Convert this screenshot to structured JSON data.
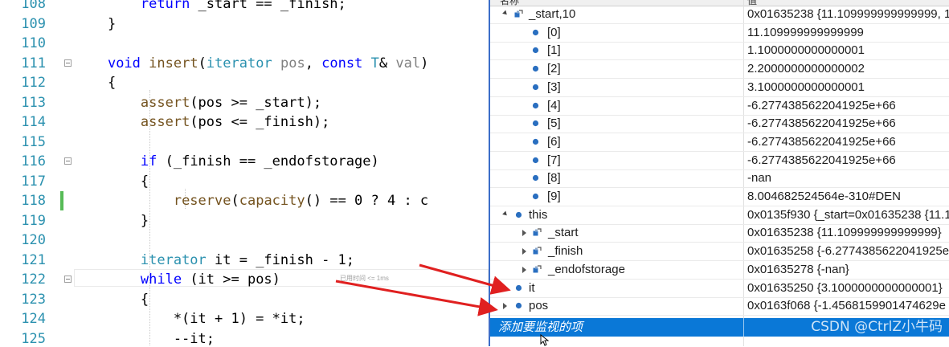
{
  "editor": {
    "lines": [
      {
        "num": "108",
        "tokens": [
          {
            "t": "        "
          },
          {
            "t": "return",
            "c": "kw"
          },
          {
            "t": " _start == _finish;"
          }
        ]
      },
      {
        "num": "109",
        "tokens": [
          {
            "t": "    }"
          }
        ]
      },
      {
        "num": "110",
        "tokens": []
      },
      {
        "num": "111",
        "fold": true,
        "tokens": [
          {
            "t": "    "
          },
          {
            "t": "void",
            "c": "kw"
          },
          {
            "t": " "
          },
          {
            "t": "insert",
            "c": "fn"
          },
          {
            "t": "("
          },
          {
            "t": "iterator",
            "c": "ty"
          },
          {
            "t": " "
          },
          {
            "t": "pos",
            "c": "pa"
          },
          {
            "t": ", "
          },
          {
            "t": "const",
            "c": "kw"
          },
          {
            "t": " "
          },
          {
            "t": "T",
            "c": "ty"
          },
          {
            "t": "& "
          },
          {
            "t": "val",
            "c": "pa"
          },
          {
            "t": ")"
          }
        ]
      },
      {
        "num": "112",
        "tokens": [
          {
            "t": "    {"
          }
        ]
      },
      {
        "num": "113",
        "tokens": [
          {
            "t": "        "
          },
          {
            "t": "assert",
            "c": "fn"
          },
          {
            "t": "(pos >= _start);"
          }
        ]
      },
      {
        "num": "114",
        "tokens": [
          {
            "t": "        "
          },
          {
            "t": "assert",
            "c": "fn"
          },
          {
            "t": "(pos <= _finish);"
          }
        ]
      },
      {
        "num": "115",
        "tokens": []
      },
      {
        "num": "116",
        "fold": true,
        "tokens": [
          {
            "t": "        "
          },
          {
            "t": "if",
            "c": "kw"
          },
          {
            "t": " (_finish == _endofstorage)"
          }
        ]
      },
      {
        "num": "117",
        "tokens": [
          {
            "t": "        {"
          }
        ]
      },
      {
        "num": "118",
        "changed": true,
        "tokens": [
          {
            "t": "            "
          },
          {
            "t": "reserve",
            "c": "fn"
          },
          {
            "t": "("
          },
          {
            "t": "capacity",
            "c": "fn"
          },
          {
            "t": "() == 0 ? 4 : c"
          }
        ]
      },
      {
        "num": "119",
        "tokens": [
          {
            "t": "        }"
          }
        ]
      },
      {
        "num": "120",
        "tokens": []
      },
      {
        "num": "121",
        "tokens": [
          {
            "t": "        "
          },
          {
            "t": "iterator",
            "c": "ty"
          },
          {
            "t": " it = _finish - 1;"
          }
        ]
      },
      {
        "num": "122",
        "fold": true,
        "tokens": [
          {
            "t": "        "
          },
          {
            "t": "while",
            "c": "kw"
          },
          {
            "t": " (it >= pos)"
          }
        ]
      },
      {
        "num": "123",
        "tokens": [
          {
            "t": "        {"
          }
        ]
      },
      {
        "num": "124",
        "tokens": [
          {
            "t": "            *(it + 1) = *it;"
          }
        ]
      },
      {
        "num": "125",
        "tokens": [
          {
            "t": "            --it;"
          }
        ]
      }
    ],
    "perf_tip": "已用时间 <= 1ms"
  },
  "watch": {
    "header": {
      "name_col": "名称",
      "value_col": "值"
    },
    "rows": [
      {
        "name": "_start,10",
        "value": "0x01635238 {11.109999999999999, 1",
        "indent": 0,
        "expander": "open",
        "icon": "field"
      },
      {
        "name": "[0]",
        "value": "11.109999999999999",
        "indent": 2,
        "icon": "var"
      },
      {
        "name": "[1]",
        "value": "1.1000000000000001",
        "indent": 2,
        "icon": "var"
      },
      {
        "name": "[2]",
        "value": "2.2000000000000002",
        "indent": 2,
        "icon": "var"
      },
      {
        "name": "[3]",
        "value": "3.1000000000000001",
        "indent": 2,
        "icon": "var"
      },
      {
        "name": "[4]",
        "value": "-6.2774385622041925e+66",
        "indent": 2,
        "icon": "var"
      },
      {
        "name": "[5]",
        "value": "-6.2774385622041925e+66",
        "indent": 2,
        "icon": "var"
      },
      {
        "name": "[6]",
        "value": "-6.2774385622041925e+66",
        "indent": 2,
        "icon": "var"
      },
      {
        "name": "[7]",
        "value": "-6.2774385622041925e+66",
        "indent": 2,
        "icon": "var"
      },
      {
        "name": "[8]",
        "value": "-nan",
        "indent": 2,
        "icon": "var"
      },
      {
        "name": "[9]",
        "value": "8.004682524564e-310#DEN",
        "indent": 2,
        "icon": "var"
      },
      {
        "name": "this",
        "value": "0x0135f930 {_start=0x01635238 {11.1",
        "indent": 0,
        "expander": "open",
        "icon": "var"
      },
      {
        "name": "_start",
        "value": "0x01635238 {11.109999999999999}",
        "indent": 1,
        "expander": "closed",
        "icon": "field"
      },
      {
        "name": "_finish",
        "value": "0x01635258 {-6.2774385622041925e",
        "indent": 1,
        "expander": "closed",
        "icon": "field"
      },
      {
        "name": "_endofstorage",
        "value": "0x01635278 {-nan}",
        "indent": 1,
        "expander": "closed",
        "icon": "field"
      },
      {
        "name": "it",
        "value": "0x01635250 {3.1000000000000001}",
        "indent": 0,
        "expander": "closed",
        "icon": "var"
      },
      {
        "name": "pos",
        "value": "0x0163f068 {-1.4568159901474629e",
        "indent": 0,
        "expander": "closed",
        "icon": "var"
      }
    ],
    "add_item": "添加要监视的项",
    "watermark": "CSDN @CtrlZ小牛码"
  },
  "colors": {
    "keyword": "#0000ff",
    "type": "#2b91af",
    "function": "#74531f",
    "parameter": "#808080",
    "line_number": "#2b91af",
    "selection": "#0a78d7",
    "arrow": "#e02020",
    "change_bar": "#57bb57"
  }
}
